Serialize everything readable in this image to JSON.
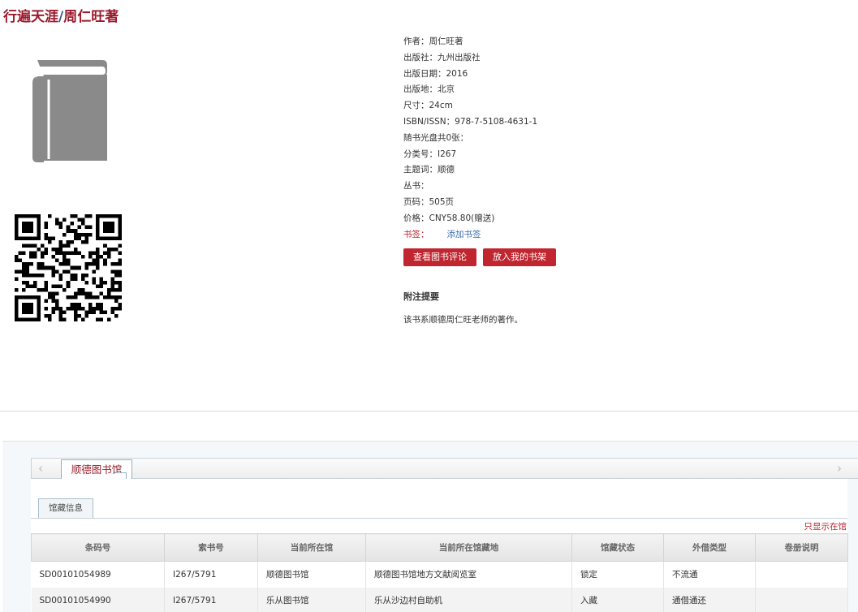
{
  "header": {
    "title_part1": "行遍天涯",
    "separator": "/",
    "title_part2": "周仁旺著"
  },
  "icons": {
    "cover": "book-cover-icon",
    "qr": "qr-code"
  },
  "details": [
    {
      "label": "作者：",
      "value": "周仁旺著"
    },
    {
      "label": "出版社：",
      "value": "九州出版社"
    },
    {
      "label": "出版日期：",
      "value": "2016"
    },
    {
      "label": "出版地：",
      "value": "北京"
    },
    {
      "label": "尺寸：",
      "value": "24cm"
    },
    {
      "label": "ISBN/ISSN：",
      "value": "978-7-5108-4631-1"
    },
    {
      "label": "随书光盘共0张：",
      "value": ""
    },
    {
      "label": "分类号：",
      "value": "I267"
    },
    {
      "label": "主题词：",
      "value": "顺德"
    },
    {
      "label": "丛书：",
      "value": ""
    },
    {
      "label": "页码：",
      "value": "505页"
    },
    {
      "label": "价格：",
      "value": "CNY58.80(赠送)"
    }
  ],
  "tag": {
    "label": "书签：",
    "add_link": "添加书签"
  },
  "buttons": {
    "review": "查看图书评论",
    "shelf": "放入我的书架"
  },
  "note": {
    "heading": "附注提要",
    "text": "该书系顺德周仁旺老师的著作。"
  },
  "library_tabs": {
    "prev_arrow": "‹",
    "next_arrow": "›",
    "active": "顺德图书馆"
  },
  "holdings": {
    "tab_label": "馆藏信息",
    "only_available_link": "只显示在馆",
    "columns": [
      "条码号",
      "索书号",
      "当前所在馆",
      "当前所在馆藏地",
      "馆藏状态",
      "外借类型",
      "卷册说明"
    ],
    "rows": [
      [
        "SD00101054989",
        "I267/5791",
        "顺德图书馆",
        "顺德图书馆地方文献阅览室",
        "锁定",
        "不流通",
        ""
      ],
      [
        "SD00101054990",
        "I267/5791",
        "乐从图书馆",
        "乐从沙边村自助机",
        "入藏",
        "通借通还",
        ""
      ]
    ]
  },
  "colors": {
    "title": "#9a1b2c",
    "button": "#c0262f",
    "link": "#3a6fb0",
    "tag_label": "#b5232f"
  }
}
